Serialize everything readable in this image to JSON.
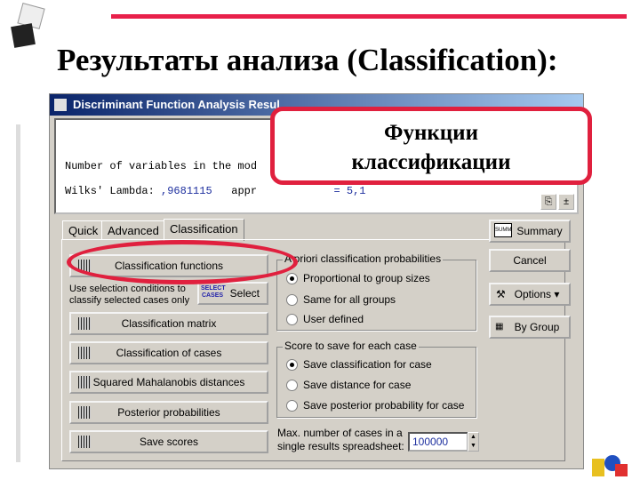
{
  "slide": {
    "title": "Результаты анализа (Classification):",
    "callout": [
      "Функции",
      "классификации"
    ]
  },
  "window": {
    "title": "Discriminant Function Analysis Resul",
    "lines": {
      "l1": "Number of variables in the mod",
      "l2a": "Wilks' Lambda: ",
      "l2b": ",9681115",
      "l2c": "   appr",
      "l2d": "= 5,1"
    }
  },
  "tabs": [
    "Quick",
    "Advanced",
    "Classification"
  ],
  "buttons": {
    "class_functions": "Classification functions",
    "select_note": "Use selection conditions to classify selected cases only",
    "select_icon": "SELECT CASES",
    "select": "Select",
    "class_matrix": "Classification matrix",
    "class_cases": "Classification of cases",
    "mahalanobis": "Squared Mahalanobis distances",
    "posterior": "Posterior probabilities",
    "save_scores": "Save scores"
  },
  "apriori": {
    "legend": "A priori classification probabilities",
    "options": [
      "Proportional to group sizes",
      "Same for all groups",
      "User defined"
    ],
    "selected": 0
  },
  "score": {
    "legend": "Score to save for each case",
    "options": [
      "Save classification for case",
      "Save distance for case",
      "Save posterior probability for case"
    ],
    "selected": 0
  },
  "maxcases": {
    "label": "Max. number of cases in a single results spreadsheet:",
    "value": "100000"
  },
  "side": {
    "summary": "Summary",
    "summary_icon": "SUMM",
    "cancel": "Cancel",
    "options": "Options ▾",
    "bygroup": "By Group"
  },
  "colors": {
    "accent": "#e0203e",
    "titlebar": "#0a246a"
  }
}
